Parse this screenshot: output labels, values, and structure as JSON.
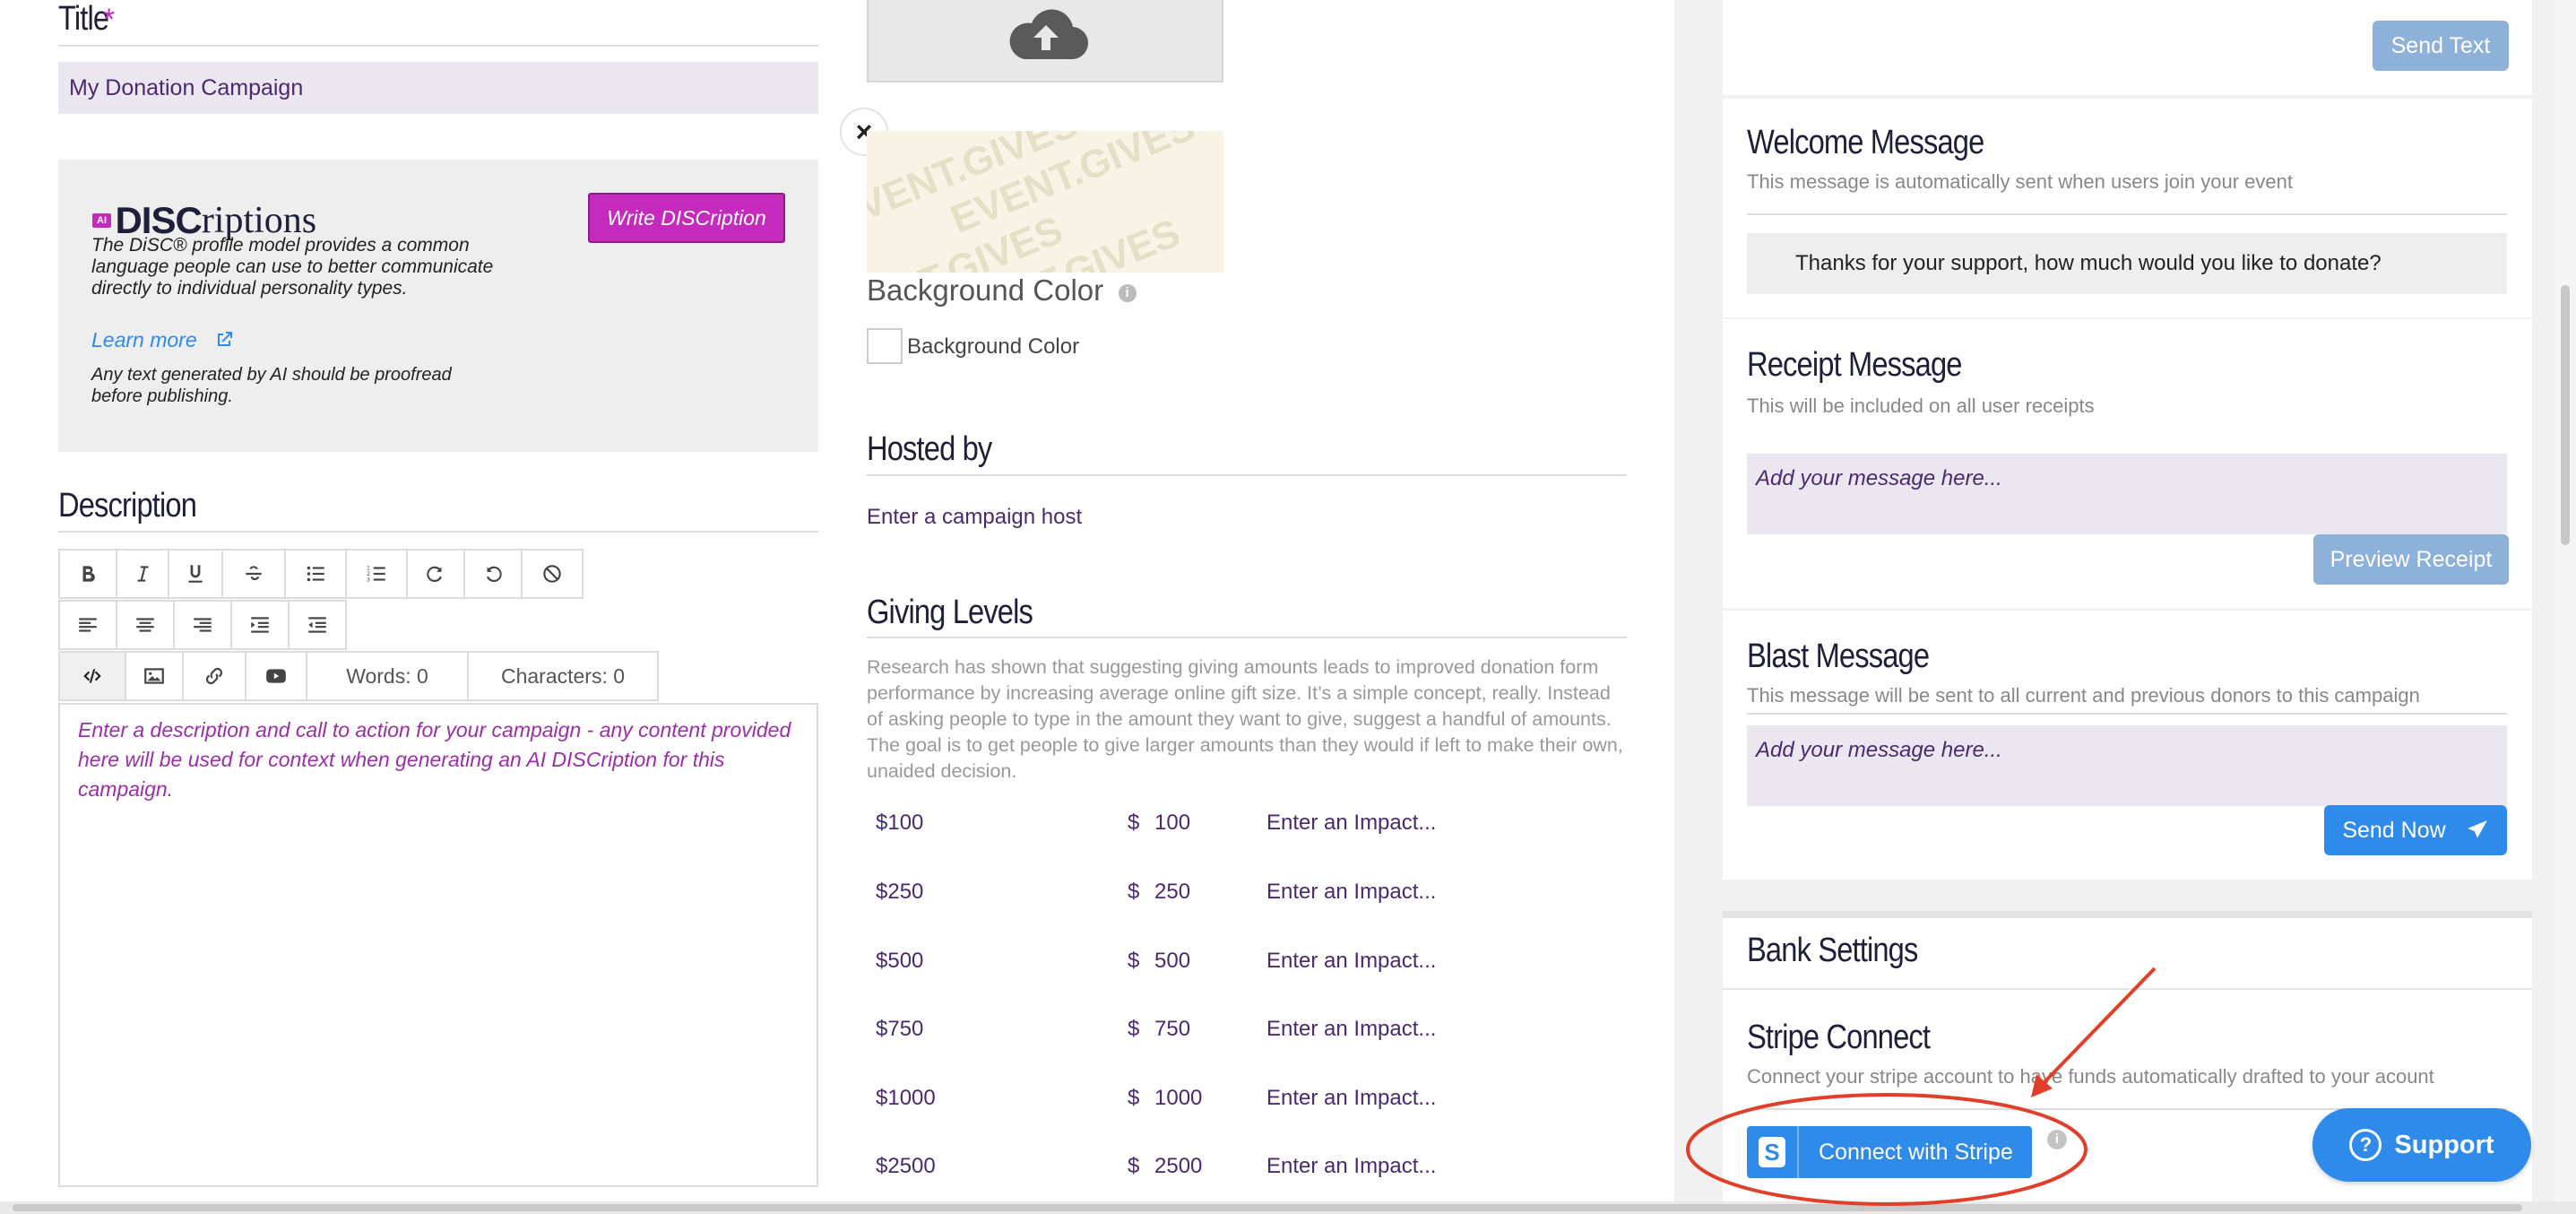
{
  "left": {
    "title_label": "Title",
    "title_required": "*",
    "title_value": "My Donation Campaign",
    "ai_badge": "AI",
    "disc_logo_bold": "DISC",
    "disc_logo_rest": "riptions",
    "disc_text": "The DiSC® profile model provides a common language people can use to better communicate directly to individual personality types.",
    "learn_more": "Learn more",
    "ai_note": "Any text generated by AI should be proofread before publishing.",
    "write_button": "Write DISCription",
    "description_label": "Description",
    "words_count": "Words: 0",
    "chars_count": "Characters: 0",
    "editor_placeholder": "Enter a description and call to action for your campaign - any content provided here will be used for context when generating an AI DISCription for this campaign."
  },
  "middle": {
    "close_symbol": "×",
    "background_color_title": "Background Color",
    "background_color_checkbox_label": "Background Color",
    "watermark_text": "EVENT.GIVES",
    "hosted_by_title": "Hosted by",
    "hosted_by_placeholder": "Enter a campaign host",
    "giving_levels_title": "Giving Levels",
    "giving_levels_text": "Research has shown that suggesting giving amounts leads to improved donation form performance by increasing average online gift size. It’s a simple concept, really. Instead of asking people to type in the amount they want to give, suggest a handful of amounts. The goal is to get people to give larger amounts than they would if left to make their own, unaided decision.",
    "levels": [
      {
        "label": "$100",
        "currency": "$",
        "amount": "100",
        "impact": "Enter an Impact..."
      },
      {
        "label": "$250",
        "currency": "$",
        "amount": "250",
        "impact": "Enter an Impact..."
      },
      {
        "label": "$500",
        "currency": "$",
        "amount": "500",
        "impact": "Enter an Impact..."
      },
      {
        "label": "$750",
        "currency": "$",
        "amount": "750",
        "impact": "Enter an Impact..."
      },
      {
        "label": "$1000",
        "currency": "$",
        "amount": "1000",
        "impact": "Enter an Impact..."
      },
      {
        "label": "$2500",
        "currency": "$",
        "amount": "2500",
        "impact": "Enter an Impact..."
      }
    ]
  },
  "right": {
    "send_text_button": "Send Text",
    "welcome_title": "Welcome Message",
    "welcome_desc": "This message is automatically sent when users join your event",
    "welcome_value": "Thanks for your support, how much would you like to donate?",
    "receipt_title": "Receipt Message",
    "receipt_desc": "This will be included on all user receipts",
    "receipt_placeholder": "Add your message here...",
    "preview_receipt_button": "Preview Receipt",
    "blast_title": "Blast Message",
    "blast_desc": "This message will be sent to all current and previous donors to this campaign",
    "blast_placeholder": "Add your message here...",
    "send_now_button": "Send Now",
    "bank_settings_title": "Bank Settings",
    "stripe_title": "Stripe Connect",
    "stripe_desc": "Connect your stripe account to have funds automatically drafted to your acount",
    "connect_stripe_button": "Connect with Stripe",
    "stripe_letter": "S",
    "support_button": "Support"
  },
  "colors": {
    "accent_blue": "#2f8bea",
    "disc_magenta": "#c42bbd",
    "annotation_red": "#e0402a",
    "text_purple": "#4a2a6e"
  }
}
